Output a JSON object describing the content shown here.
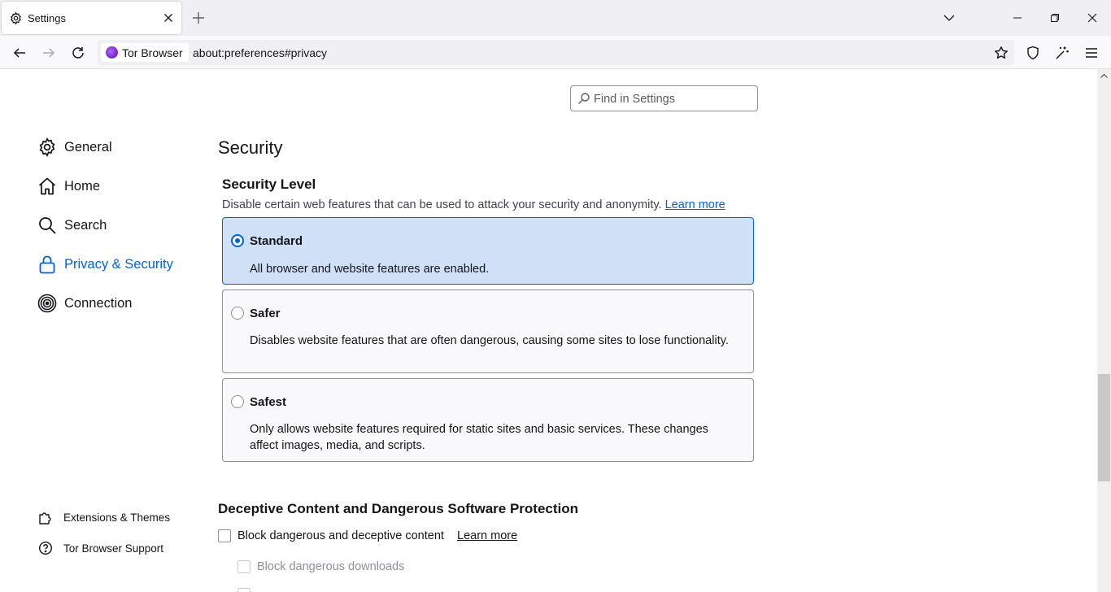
{
  "tab": {
    "title": "Settings",
    "icon": "gear-icon"
  },
  "window_controls": {
    "list_all_tabs": "chevron-down-icon",
    "minimize": "minimize-icon",
    "restore": "restore-icon",
    "close": "close-icon"
  },
  "urlbar": {
    "identity_label": "Tor Browser",
    "url": "about:preferences#privacy"
  },
  "toolbar_icons": [
    "star-icon",
    "shield-icon",
    "magic-wand-icon",
    "hamburger-menu-icon"
  ],
  "find": {
    "placeholder": "Find in Settings"
  },
  "sidebar": {
    "items": [
      {
        "label": "General",
        "icon": "gear-icon",
        "active": false
      },
      {
        "label": "Home",
        "icon": "home-icon",
        "active": false
      },
      {
        "label": "Search",
        "icon": "search-icon",
        "active": false
      },
      {
        "label": "Privacy & Security",
        "icon": "lock-icon",
        "active": true
      },
      {
        "label": "Connection",
        "icon": "onion-icon",
        "active": false
      }
    ],
    "footer": [
      {
        "label": "Extensions & Themes",
        "icon": "puzzle-icon"
      },
      {
        "label": "Tor Browser Support",
        "icon": "help-icon"
      }
    ]
  },
  "security": {
    "heading": "Security",
    "subheading": "Security Level",
    "description": "Disable certain web features that can be used to attack your security and anonymity.",
    "learn_more": "Learn more",
    "levels": [
      {
        "name": "Standard",
        "description": "All browser and website features are enabled.",
        "selected": true
      },
      {
        "name": "Safer",
        "description": "Disables website features that are often dangerous, causing some sites to lose functionality.",
        "selected": false
      },
      {
        "name": "Safest",
        "description": "Only allows website features required for static sites and basic services. These changes affect images, media, and scripts.",
        "selected": false
      }
    ]
  },
  "deceptive": {
    "heading": "Deceptive Content and Dangerous Software Protection",
    "block_label": "Block dangerous and deceptive content",
    "learn_more": "Learn more",
    "downloads_label": "Block dangerous downloads"
  },
  "colors": {
    "accent": "#0061e0",
    "selected_bg": "#cfe0f7"
  }
}
